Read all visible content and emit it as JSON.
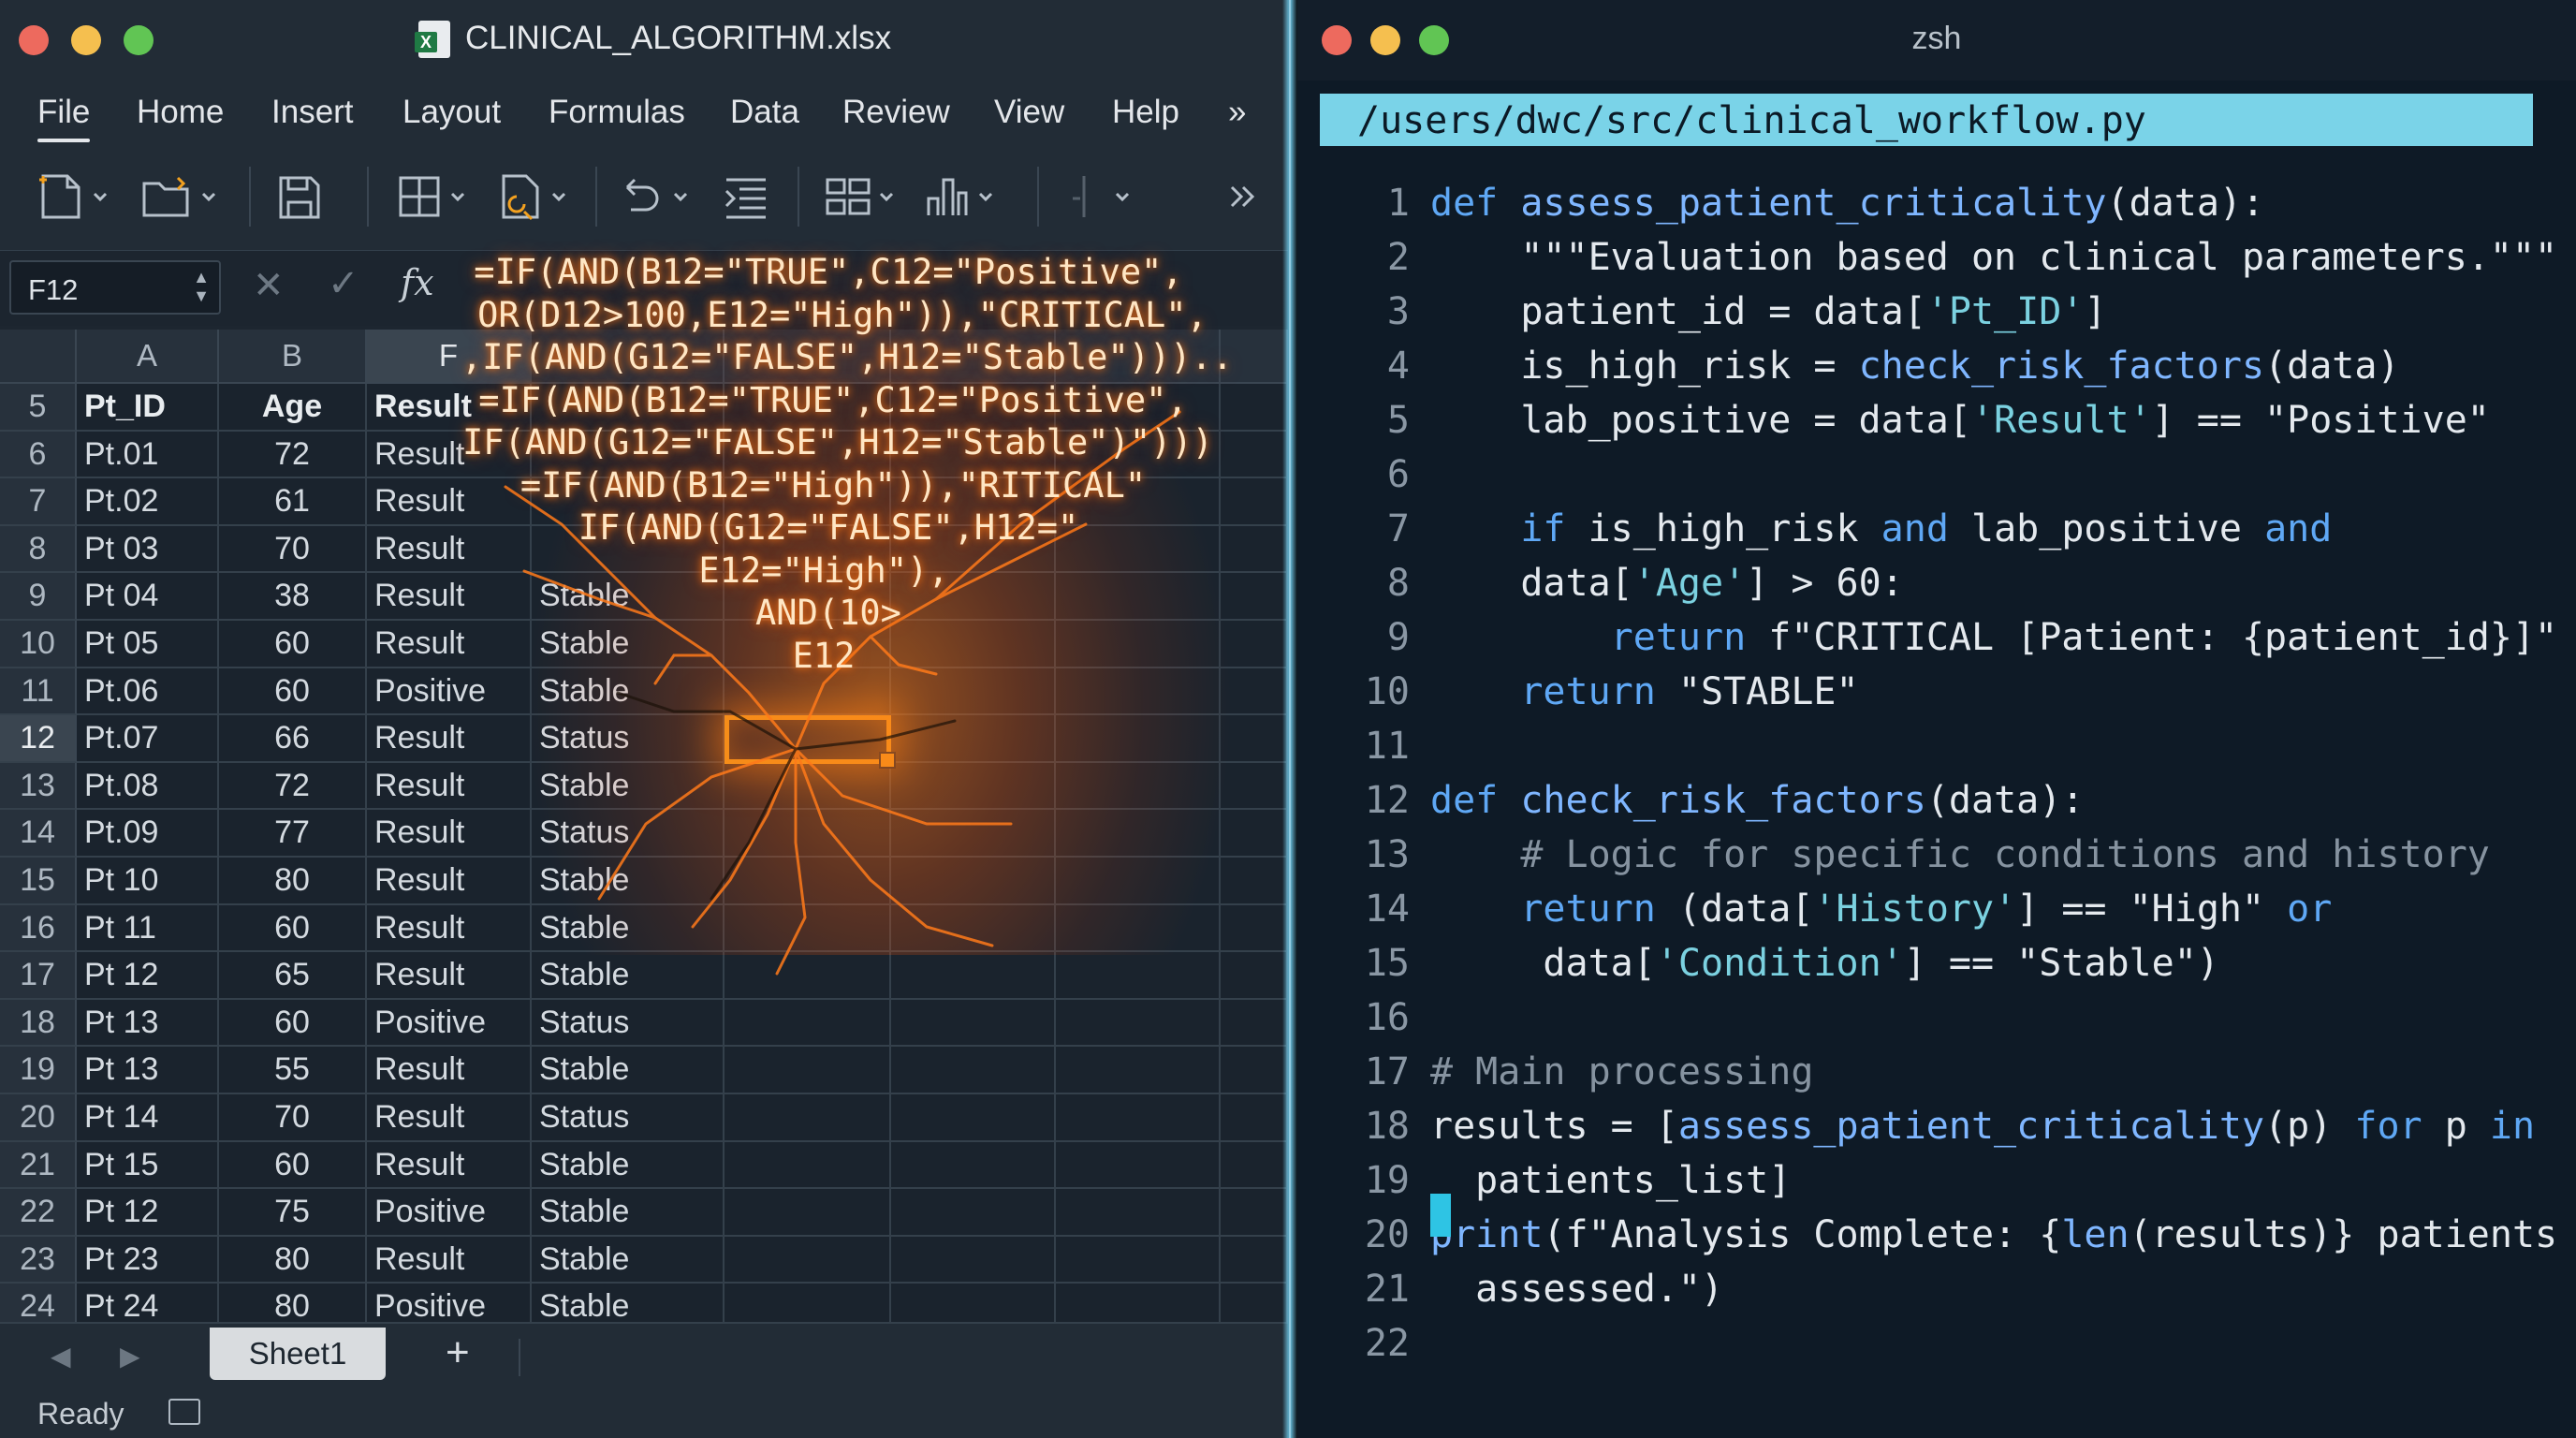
{
  "excel": {
    "title": "CLINICAL_ALGORITHM.xlsx",
    "menu": [
      "File",
      "Home",
      "Insert",
      "Layout",
      "Formulas",
      "Data",
      "Review",
      "View",
      "Help"
    ],
    "menu_more": "»",
    "name_box": "F12",
    "fx": "fx",
    "columns": [
      "A",
      "B",
      "F"
    ],
    "rows": [
      {
        "n": "5",
        "a": "Pt_ID",
        "b": "Age",
        "f": "Result",
        "g": ""
      },
      {
        "n": "6",
        "a": "Pt.01",
        "b": "72",
        "f": "Result",
        "g": ""
      },
      {
        "n": "7",
        "a": "Pt.02",
        "b": "61",
        "f": "Result",
        "g": ""
      },
      {
        "n": "8",
        "a": "Pt 03",
        "b": "70",
        "f": "Result",
        "g": ""
      },
      {
        "n": "9",
        "a": "Pt 04",
        "b": "38",
        "f": "Result",
        "g": "Stable"
      },
      {
        "n": "10",
        "a": "Pt 05",
        "b": "60",
        "f": "Result",
        "g": "Stable"
      },
      {
        "n": "11",
        "a": "Pt.06",
        "b": "60",
        "f": "Positive",
        "g": "Stable"
      },
      {
        "n": "12",
        "a": "Pt.07",
        "b": "66",
        "f": "Result",
        "g": "Status"
      },
      {
        "n": "13",
        "a": "Pt.08",
        "b": "72",
        "f": "Result",
        "g": "Stable"
      },
      {
        "n": "14",
        "a": "Pt.09",
        "b": "77",
        "f": "Result",
        "g": "Status"
      },
      {
        "n": "15",
        "a": "Pt 10",
        "b": "80",
        "f": "Result",
        "g": "Stable"
      },
      {
        "n": "16",
        "a": "Pt 11",
        "b": "60",
        "f": "Result",
        "g": "Stable"
      },
      {
        "n": "17",
        "a": "Pt 12",
        "b": "65",
        "f": "Result",
        "g": "Stable"
      },
      {
        "n": "18",
        "a": "Pt 13",
        "b": "60",
        "f": "Positive",
        "g": "Status"
      },
      {
        "n": "19",
        "a": "Pt 13",
        "b": "55",
        "f": "Result",
        "g": "Stable"
      },
      {
        "n": "20",
        "a": "Pt 14",
        "b": "70",
        "f": "Result",
        "g": "Status"
      },
      {
        "n": "21",
        "a": "Pt 15",
        "b": "60",
        "f": "Result",
        "g": "Stable"
      },
      {
        "n": "22",
        "a": "Pt 12",
        "b": "75",
        "f": "Positive",
        "g": "Stable"
      },
      {
        "n": "23",
        "a": "Pt 23",
        "b": "80",
        "f": "Result",
        "g": "Stable"
      },
      {
        "n": "24",
        "a": "Pt 24",
        "b": "80",
        "f": "Positive",
        "g": "Stable"
      }
    ],
    "formula_lines": [
      "=IF(AND(B12=\"TRUE\",C12=\"Positive\",",
      "OR(D12>100,E12=\"High\")),\"CRITICAL\",",
      ",IF(AND(G12=\"FALSE\",H12=\"Stable\")))..",
      "=IF(AND(B12=\"TRUE\",C12=\"Positive\",",
      "IF(AND(G12=\"FALSE\",H12=\"Stable\")\")))",
      "=IF(AND(B12=\"High\")),\"RITICAL\"",
      "IF(AND(G12=\"FALSE\",H12=\"",
      "E12=\"High\"),",
      "AND(10>",
      "E12"
    ],
    "sheet_tab": "Sheet1",
    "add_sheet": "+",
    "status": "Ready"
  },
  "terminal": {
    "title": "zsh",
    "path": "/users/dwc/src/clinical_workflow.py",
    "line_numbers": [
      "1",
      "2",
      "3",
      "4",
      "5",
      "6",
      "7",
      "8",
      "9",
      "10",
      "11",
      "12",
      "13",
      "14",
      "15",
      "16",
      "17",
      "18",
      "19",
      "20",
      "21",
      "22"
    ],
    "code_lines": [
      "def assess_patient_criticality(data):",
      "    \"\"\"Evaluation based on clinical parameters.\"\"\"",
      "    patient_id = data['Pt_ID']",
      "    is_high_risk = check_risk_factors(data)",
      "    lab_positive = data['Result'] == \"Positive\"",
      "",
      "    if is_high_risk and lab_positive and",
      "    data['Age'] > 60:",
      "        return f\"CRITICAL [Patient: {patient_id}]\"",
      "    return \"STABLE\"",
      "",
      "def check_risk_factors(data):",
      "    # Logic for specific conditions and history",
      "    return (data['History'] == \"High\" or",
      "     data['Condition'] == \"Stable\")",
      "",
      "# Main processing",
      "results = [assess_patient_criticality(p) for p in",
      "  patients_list]",
      "print(f\"Analysis Complete: {len(results)} patients",
      "  assessed.\")",
      ""
    ]
  },
  "colors": {
    "accent_orange": "#f3a11f",
    "terminal_path_bg": "#7ad3e8",
    "keyword_blue": "#5fa8f5",
    "cursor": "#2ec4e4"
  }
}
